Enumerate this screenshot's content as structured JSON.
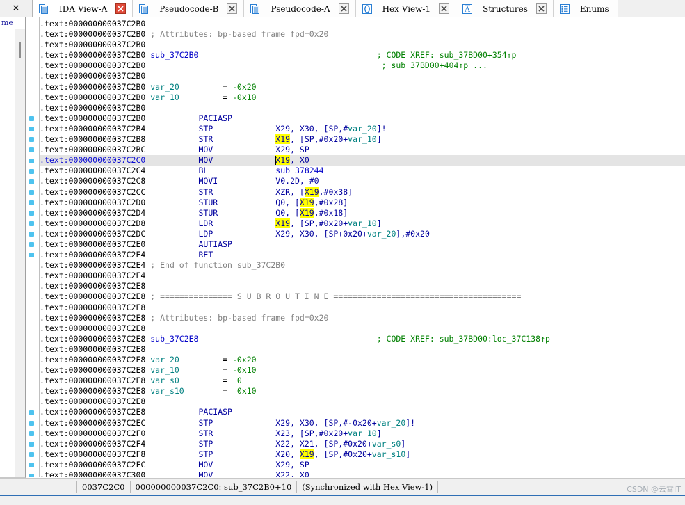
{
  "window": {
    "app": "IDA Pro",
    "close_glyph": "✕"
  },
  "tabs": [
    {
      "label": "IDA View-A",
      "icon": "document-list-icon",
      "active": true,
      "closable": true,
      "close_glyph": "✕",
      "close_style": "red"
    },
    {
      "label": "Pseudocode-B",
      "icon": "document-list-icon",
      "active": false,
      "closable": true,
      "close_glyph": "✕",
      "close_style": "grey"
    },
    {
      "label": "Pseudocode-A",
      "icon": "document-list-icon",
      "active": false,
      "closable": true,
      "close_glyph": "✕",
      "close_style": "grey"
    },
    {
      "label": "Hex View-1",
      "icon": "hex-view-icon",
      "active": false,
      "closable": true,
      "close_glyph": "✕",
      "close_style": "grey"
    },
    {
      "label": "Structures",
      "icon": "structures-icon",
      "active": false,
      "closable": true,
      "close_glyph": "✕",
      "close_style": "grey"
    },
    {
      "label": "Enums",
      "icon": "enums-icon",
      "active": false,
      "closable": false,
      "close_glyph": "",
      "close_style": "none"
    }
  ],
  "left_panel": {
    "header": "me"
  },
  "colors": {
    "highlight_bg": "#ffff00",
    "current_line_bg": "#e4e4e4",
    "marker": "#4ec3ef",
    "comment": "#808080",
    "xref": "#008000",
    "instruction": "#00009e",
    "name": "#0000c8",
    "variable": "#008080"
  },
  "disassembly": {
    "segment": ".text",
    "lines": [
      {
        "addr": "000000000037C2B0",
        "marker": false,
        "cur": false,
        "tokens": []
      },
      {
        "addr": "000000000037C2B0",
        "marker": false,
        "cur": false,
        "tokens": [
          {
            "t": "cmt",
            "v": "; Attributes: bp-based frame fpd=0x20"
          }
        ]
      },
      {
        "addr": "000000000037C2B0",
        "marker": false,
        "cur": false,
        "tokens": []
      },
      {
        "addr": "000000000037C2B0",
        "marker": false,
        "cur": false,
        "tokens": [
          {
            "t": "sub",
            "v": "sub_37C2B0"
          },
          {
            "t": "pad",
            "v": 37
          },
          {
            "t": "xref",
            "v": "; CODE XREF: sub_37BD00+354↑p"
          }
        ]
      },
      {
        "addr": "000000000037C2B0",
        "marker": false,
        "cur": false,
        "tokens": [
          {
            "t": "pad",
            "v": 48
          },
          {
            "t": "xref",
            "v": "; sub_37BD00+404↑p ..."
          }
        ]
      },
      {
        "addr": "000000000037C2B0",
        "marker": false,
        "cur": false,
        "tokens": []
      },
      {
        "addr": "000000000037C2B0",
        "marker": false,
        "cur": false,
        "tokens": [
          {
            "t": "var",
            "v": "var_20"
          },
          {
            "t": "pad",
            "v": 9
          },
          {
            "t": "punct",
            "v": "= "
          },
          {
            "t": "num",
            "v": "-0x20"
          }
        ]
      },
      {
        "addr": "000000000037C2B0",
        "marker": false,
        "cur": false,
        "tokens": [
          {
            "t": "var",
            "v": "var_10"
          },
          {
            "t": "pad",
            "v": 9
          },
          {
            "t": "punct",
            "v": "= "
          },
          {
            "t": "num",
            "v": "-0x10"
          }
        ]
      },
      {
        "addr": "000000000037C2B0",
        "marker": false,
        "cur": false,
        "tokens": []
      },
      {
        "addr": "000000000037C2B0",
        "marker": true,
        "cur": false,
        "tokens": [
          {
            "t": "pad",
            "v": 10
          },
          {
            "t": "ins",
            "v": "PACIASP"
          }
        ]
      },
      {
        "addr": "000000000037C2B4",
        "marker": true,
        "cur": false,
        "tokens": [
          {
            "t": "pad",
            "v": 10
          },
          {
            "t": "ins",
            "v": "STP"
          },
          {
            "t": "pad",
            "v": 13
          },
          {
            "t": "reg",
            "v": "X29, X30, [SP,#"
          },
          {
            "t": "var",
            "v": "var_20"
          },
          {
            "t": "reg",
            "v": "]!"
          }
        ]
      },
      {
        "addr": "000000000037C2B8",
        "marker": true,
        "cur": false,
        "tokens": [
          {
            "t": "pad",
            "v": 10
          },
          {
            "t": "ins",
            "v": "STR"
          },
          {
            "t": "pad",
            "v": 13
          },
          {
            "t": "hl",
            "v": "X19"
          },
          {
            "t": "reg",
            "v": ", [SP,#0x20+"
          },
          {
            "t": "var",
            "v": "var_10"
          },
          {
            "t": "reg",
            "v": "]"
          }
        ]
      },
      {
        "addr": "000000000037C2BC",
        "marker": true,
        "cur": false,
        "tokens": [
          {
            "t": "pad",
            "v": 10
          },
          {
            "t": "ins",
            "v": "MOV"
          },
          {
            "t": "pad",
            "v": 13
          },
          {
            "t": "reg",
            "v": "X29, SP"
          }
        ]
      },
      {
        "addr": "000000000037C2C0",
        "marker": true,
        "cur": true,
        "tokens": [
          {
            "t": "pad",
            "v": 10
          },
          {
            "t": "ins",
            "v": "MOV"
          },
          {
            "t": "pad",
            "v": 13
          },
          {
            "t": "caret",
            "v": ""
          },
          {
            "t": "hl",
            "v": "X19"
          },
          {
            "t": "reg",
            "v": ", X0"
          }
        ]
      },
      {
        "addr": "000000000037C2C4",
        "marker": true,
        "cur": false,
        "tokens": [
          {
            "t": "pad",
            "v": 10
          },
          {
            "t": "ins",
            "v": "BL"
          },
          {
            "t": "pad",
            "v": 14
          },
          {
            "t": "name",
            "v": "sub_378244"
          }
        ]
      },
      {
        "addr": "000000000037C2C8",
        "marker": true,
        "cur": false,
        "tokens": [
          {
            "t": "pad",
            "v": 10
          },
          {
            "t": "ins",
            "v": "MOVI"
          },
          {
            "t": "pad",
            "v": 12
          },
          {
            "t": "reg",
            "v": "V0.2D, #0"
          }
        ]
      },
      {
        "addr": "000000000037C2CC",
        "marker": true,
        "cur": false,
        "tokens": [
          {
            "t": "pad",
            "v": 10
          },
          {
            "t": "ins",
            "v": "STR"
          },
          {
            "t": "pad",
            "v": 13
          },
          {
            "t": "reg",
            "v": "XZR, ["
          },
          {
            "t": "hl",
            "v": "X19"
          },
          {
            "t": "reg",
            "v": ",#0x38]"
          }
        ]
      },
      {
        "addr": "000000000037C2D0",
        "marker": true,
        "cur": false,
        "tokens": [
          {
            "t": "pad",
            "v": 10
          },
          {
            "t": "ins",
            "v": "STUR"
          },
          {
            "t": "pad",
            "v": 12
          },
          {
            "t": "reg",
            "v": "Q0, ["
          },
          {
            "t": "hl",
            "v": "X19"
          },
          {
            "t": "reg",
            "v": ",#0x28]"
          }
        ]
      },
      {
        "addr": "000000000037C2D4",
        "marker": true,
        "cur": false,
        "tokens": [
          {
            "t": "pad",
            "v": 10
          },
          {
            "t": "ins",
            "v": "STUR"
          },
          {
            "t": "pad",
            "v": 12
          },
          {
            "t": "reg",
            "v": "Q0, ["
          },
          {
            "t": "hl",
            "v": "X19"
          },
          {
            "t": "reg",
            "v": ",#0x18]"
          }
        ]
      },
      {
        "addr": "000000000037C2D8",
        "marker": true,
        "cur": false,
        "tokens": [
          {
            "t": "pad",
            "v": 10
          },
          {
            "t": "ins",
            "v": "LDR"
          },
          {
            "t": "pad",
            "v": 13
          },
          {
            "t": "hl",
            "v": "X19"
          },
          {
            "t": "reg",
            "v": ", [SP,#0x20+"
          },
          {
            "t": "var",
            "v": "var_10"
          },
          {
            "t": "reg",
            "v": "]"
          }
        ]
      },
      {
        "addr": "000000000037C2DC",
        "marker": true,
        "cur": false,
        "tokens": [
          {
            "t": "pad",
            "v": 10
          },
          {
            "t": "ins",
            "v": "LDP"
          },
          {
            "t": "pad",
            "v": 13
          },
          {
            "t": "reg",
            "v": "X29, X30, [SP+0x20+"
          },
          {
            "t": "var",
            "v": "var_20"
          },
          {
            "t": "reg",
            "v": "],#0x20"
          }
        ]
      },
      {
        "addr": "000000000037C2E0",
        "marker": true,
        "cur": false,
        "tokens": [
          {
            "t": "pad",
            "v": 10
          },
          {
            "t": "ins",
            "v": "AUTIASP"
          }
        ]
      },
      {
        "addr": "000000000037C2E4",
        "marker": true,
        "cur": false,
        "tokens": [
          {
            "t": "pad",
            "v": 10
          },
          {
            "t": "ins",
            "v": "RET"
          }
        ]
      },
      {
        "addr": "000000000037C2E4",
        "marker": false,
        "cur": false,
        "tokens": [
          {
            "t": "cmt",
            "v": "; End of function sub_37C2B0"
          }
        ]
      },
      {
        "addr": "000000000037C2E4",
        "marker": false,
        "cur": false,
        "tokens": []
      },
      {
        "addr": "000000000037C2E8",
        "marker": false,
        "cur": false,
        "tokens": []
      },
      {
        "addr": "000000000037C2E8",
        "marker": false,
        "cur": false,
        "tokens": [
          {
            "t": "sep",
            "v": "; =============== S U B R O U T I N E ======================================="
          }
        ]
      },
      {
        "addr": "000000000037C2E8",
        "marker": false,
        "cur": false,
        "tokens": []
      },
      {
        "addr": "000000000037C2E8",
        "marker": false,
        "cur": false,
        "tokens": [
          {
            "t": "cmt",
            "v": "; Attributes: bp-based frame fpd=0x20"
          }
        ]
      },
      {
        "addr": "000000000037C2E8",
        "marker": false,
        "cur": false,
        "tokens": []
      },
      {
        "addr": "000000000037C2E8",
        "marker": false,
        "cur": false,
        "tokens": [
          {
            "t": "sub",
            "v": "sub_37C2E8"
          },
          {
            "t": "pad",
            "v": 37
          },
          {
            "t": "xref",
            "v": "; CODE XREF: sub_37BD00:loc_37C138↑p"
          }
        ]
      },
      {
        "addr": "000000000037C2E8",
        "marker": false,
        "cur": false,
        "tokens": []
      },
      {
        "addr": "000000000037C2E8",
        "marker": false,
        "cur": false,
        "tokens": [
          {
            "t": "var",
            "v": "var_20"
          },
          {
            "t": "pad",
            "v": 9
          },
          {
            "t": "punct",
            "v": "= "
          },
          {
            "t": "num",
            "v": "-0x20"
          }
        ]
      },
      {
        "addr": "000000000037C2E8",
        "marker": false,
        "cur": false,
        "tokens": [
          {
            "t": "var",
            "v": "var_10"
          },
          {
            "t": "pad",
            "v": 9
          },
          {
            "t": "punct",
            "v": "= "
          },
          {
            "t": "num",
            "v": "-0x10"
          }
        ]
      },
      {
        "addr": "000000000037C2E8",
        "marker": false,
        "cur": false,
        "tokens": [
          {
            "t": "var",
            "v": "var_s0"
          },
          {
            "t": "pad",
            "v": 9
          },
          {
            "t": "punct",
            "v": "= "
          },
          {
            "t": "num",
            "v": " 0"
          }
        ]
      },
      {
        "addr": "000000000037C2E8",
        "marker": false,
        "cur": false,
        "tokens": [
          {
            "t": "var",
            "v": "var_s10"
          },
          {
            "t": "pad",
            "v": 8
          },
          {
            "t": "punct",
            "v": "= "
          },
          {
            "t": "num",
            "v": " 0x10"
          }
        ]
      },
      {
        "addr": "000000000037C2E8",
        "marker": false,
        "cur": false,
        "tokens": []
      },
      {
        "addr": "000000000037C2E8",
        "marker": true,
        "cur": false,
        "tokens": [
          {
            "t": "pad",
            "v": 10
          },
          {
            "t": "ins",
            "v": "PACIASP"
          }
        ]
      },
      {
        "addr": "000000000037C2EC",
        "marker": true,
        "cur": false,
        "tokens": [
          {
            "t": "pad",
            "v": 10
          },
          {
            "t": "ins",
            "v": "STP"
          },
          {
            "t": "pad",
            "v": 13
          },
          {
            "t": "reg",
            "v": "X29, X30, [SP,#-0x20+"
          },
          {
            "t": "var",
            "v": "var_20"
          },
          {
            "t": "reg",
            "v": "]!"
          }
        ]
      },
      {
        "addr": "000000000037C2F0",
        "marker": true,
        "cur": false,
        "tokens": [
          {
            "t": "pad",
            "v": 10
          },
          {
            "t": "ins",
            "v": "STR"
          },
          {
            "t": "pad",
            "v": 13
          },
          {
            "t": "reg",
            "v": "X23, [SP,#0x20+"
          },
          {
            "t": "var",
            "v": "var_10"
          },
          {
            "t": "reg",
            "v": "]"
          }
        ]
      },
      {
        "addr": "000000000037C2F4",
        "marker": true,
        "cur": false,
        "tokens": [
          {
            "t": "pad",
            "v": 10
          },
          {
            "t": "ins",
            "v": "STP"
          },
          {
            "t": "pad",
            "v": 13
          },
          {
            "t": "reg",
            "v": "X22, X21, [SP,#0x20+"
          },
          {
            "t": "var",
            "v": "var_s0"
          },
          {
            "t": "reg",
            "v": "]"
          }
        ]
      },
      {
        "addr": "000000000037C2F8",
        "marker": true,
        "cur": false,
        "tokens": [
          {
            "t": "pad",
            "v": 10
          },
          {
            "t": "ins",
            "v": "STP"
          },
          {
            "t": "pad",
            "v": 13
          },
          {
            "t": "reg",
            "v": "X20, "
          },
          {
            "t": "hl",
            "v": "X19"
          },
          {
            "t": "reg",
            "v": ", [SP,#0x20+"
          },
          {
            "t": "var",
            "v": "var_s10"
          },
          {
            "t": "reg",
            "v": "]"
          }
        ]
      },
      {
        "addr": "000000000037C2FC",
        "marker": true,
        "cur": false,
        "tokens": [
          {
            "t": "pad",
            "v": 10
          },
          {
            "t": "ins",
            "v": "MOV"
          },
          {
            "t": "pad",
            "v": 13
          },
          {
            "t": "reg",
            "v": "X29, SP"
          }
        ]
      },
      {
        "addr": "000000000037C300",
        "marker": true,
        "cur": false,
        "tokens": [
          {
            "t": "pad",
            "v": 10
          },
          {
            "t": "ins",
            "v": "MOV"
          },
          {
            "t": "pad",
            "v": 13
          },
          {
            "t": "reg",
            "v": "X22, X0"
          }
        ]
      }
    ]
  },
  "statusbar": {
    "cells": [
      "0037C2C0",
      "000000000037C2C0: sub_37C2B0+10",
      "(Synchronized with Hex View-1)"
    ]
  },
  "watermark": "CSDN @云霄IT"
}
